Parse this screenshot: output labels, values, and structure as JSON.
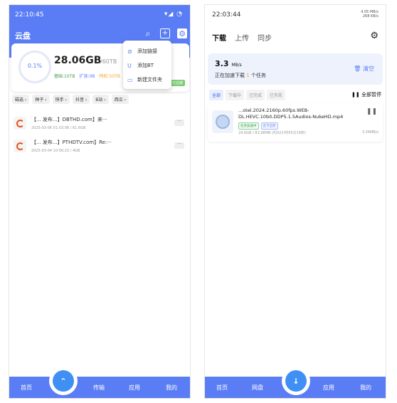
{
  "left": {
    "status_time": "22:10:45",
    "status_icons": "▾◢ ◔",
    "title": "云盘",
    "storage": {
      "percent": "0.1%",
      "used": "28.06GB",
      "total": "/60TB",
      "basic": "基础:10TB",
      "expand": "扩容:0B",
      "special": "特权:50TB",
      "badge": "已过期"
    },
    "menu": [
      {
        "icon": "link-icon",
        "label": "添加链接"
      },
      {
        "icon": "magnet-icon",
        "label": "添加BT"
      },
      {
        "icon": "folder-icon",
        "label": "新建文件夹"
      }
    ],
    "chips": [
      "磁选 ›",
      "种子 ›",
      "快手 ›",
      "抖音 ›",
      "B站 ›",
      "西瓜 ›"
    ],
    "files": [
      {
        "name": "【... 发布...】DBTHD.com】来···",
        "meta": "2025-03-06 01:03:08 / 61.6GB"
      },
      {
        "name": "【... 发布...】PTHDTV.com】Re:···",
        "meta": "2025-03-04 10:56:23 / 4GB"
      }
    ],
    "nav": {
      "home": "首页",
      "transfer": "传输",
      "apps": "应用",
      "mine": "我的",
      "fab": "⌃"
    }
  },
  "right": {
    "status_time": "22:03:44",
    "status_net_1": "4.05 MB/s",
    "status_net_2": "268 KB/s",
    "tabs": [
      "下载",
      "上传",
      "同步"
    ],
    "speed": {
      "value": "3.3",
      "unit": "MB/s",
      "desc_prefix": "正在加速下载",
      "count": "1",
      "desc_suffix": "个任务"
    },
    "clear_label": "清空",
    "filters": [
      "全部",
      "下载中",
      "已完成",
      "已失败"
    ],
    "pause_all": "❚❚ 全部暂停",
    "task": {
      "name": "...otel.2024.2160p.60fps.WEB-DL.HEVC.10bit.DDP5.1.5Audios-NukeHD.mp4",
      "badge_accel": "任务加速中",
      "badge_cloud": "云下已存",
      "meta": "24.6GB / 83.98MB (约02小时55分19秒)",
      "rate": "3.34MB/s"
    },
    "nav": {
      "home": "首页",
      "disk": "网盘",
      "apps": "应用",
      "mine": "我的",
      "fab": "↓"
    }
  },
  "colors": {
    "accent": "#5a7df5",
    "orange": "#f5a623",
    "green": "#43a047"
  }
}
